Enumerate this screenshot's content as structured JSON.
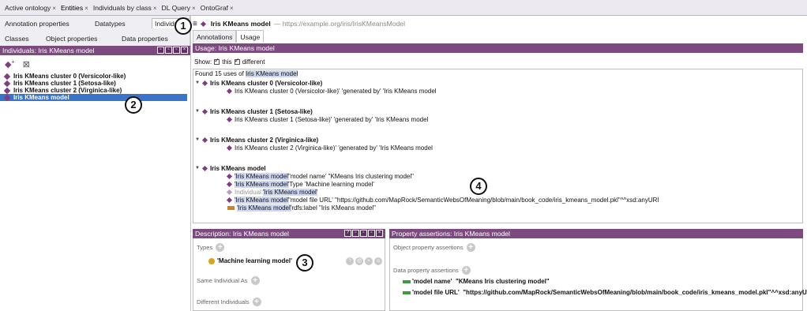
{
  "top_tabs": [
    {
      "label": "Active ontology",
      "close": "×"
    },
    {
      "label": "Entities",
      "close": "×"
    },
    {
      "label": "Individuals by class",
      "close": "×"
    },
    {
      "label": "DL Query",
      "close": "×"
    },
    {
      "label": "OntoGraf",
      "close": "×"
    }
  ],
  "left_tabs": {
    "annotation_properties": "Annotation properties",
    "datatypes": "Datatypes",
    "individuals": "Individuals",
    "classes": "Classes",
    "object_properties": "Object properties",
    "data_properties": "Data properties"
  },
  "individuals_panel": {
    "title": "Individuals: Iris KMeans model",
    "items": [
      "Iris KMeans cluster 0 (Versicolor-like)",
      "Iris KMeans cluster 1 (Setosa-like)",
      "Iris KMeans cluster 2 (Virginica-like)",
      "Iris KMeans model"
    ]
  },
  "header": {
    "title": "Iris KMeans model",
    "iri": "— https://example.org/iris/IrisKMeansModel",
    "menu_glyph": "≡"
  },
  "right_tabs": {
    "annotations": "Annotations",
    "usage": "Usage"
  },
  "usage": {
    "title": "Usage: Iris KMeans model",
    "show_label": "Show:",
    "this_label": "this",
    "different_label": "different",
    "found_prefix": "Found 15 uses of ",
    "found_target": "Iris KMeans model",
    "groups": [
      {
        "head": "Iris KMeans cluster 0 (Versicolor-like)",
        "items": [
          "Iris KMeans cluster 0 (Versicolor-like)' 'generated by' 'Iris KMeans model"
        ]
      },
      {
        "head": "Iris KMeans cluster 1 (Setosa-like)",
        "items": [
          "Iris KMeans cluster 1 (Setosa-like)' 'generated by' 'Iris KMeans model"
        ]
      },
      {
        "head": "Iris KMeans cluster 2 (Virginica-like)",
        "items": [
          "Iris KMeans cluster 2 (Virginica-like)' 'generated by' 'Iris KMeans model"
        ]
      }
    ],
    "model_group": {
      "head": "Iris KMeans model",
      "subject": "'Iris KMeans model'",
      "line1_rest": " 'model name' \"KMeans Iris clustering model\"",
      "line2_rest": " Type 'Machine learning model'",
      "line3_prefix": "Individual: ",
      "line3_value": "'Iris KMeans model'",
      "line4_rest": " 'model file URL' \"https://github.com/MapRock/SemanticWebsOfMeaning/blob/main/book_code/iris_kmeans_model.pkl\"^^xsd:anyURI",
      "line5_rest": " rdfs:label \"Iris KMeans model\""
    }
  },
  "description": {
    "title": "Description: Iris KMeans model",
    "types_label": "Types",
    "type_value": "'Machine learning model'",
    "same_label": "Same Individual As",
    "different_label": "Different Individuals"
  },
  "properties": {
    "title": "Property assertions: Iris KMeans model",
    "object_label": "Object property assertions",
    "data_label": "Data property assertions",
    "data_items": [
      {
        "prop": "'model name'",
        "value": "\"KMeans Iris clustering model\""
      },
      {
        "prop": "'model file URL'",
        "value": "\"https://github.com/MapRock/SemanticWebsOfMeaning/blob/main/book_code/iris_kmeans_model.pkl\"^^xsd:anyURI"
      }
    ]
  },
  "callouts": [
    "1",
    "2",
    "3",
    "4"
  ],
  "colors": {
    "accent_purple": "#7d4a80",
    "selection_blue": "#3a74c9",
    "data_green": "#3c9b3c"
  }
}
